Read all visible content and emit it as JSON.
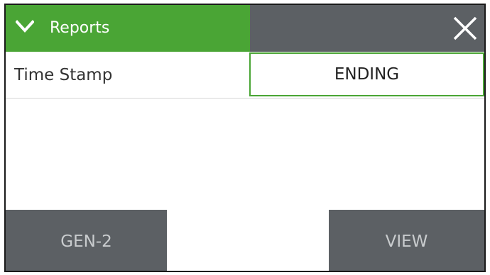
{
  "header": {
    "title": "Reports",
    "chevron_icon": "chevron-down-icon",
    "close_icon": "close-icon",
    "accent_color": "#4aa535",
    "bar_color": "#5c6064"
  },
  "setting": {
    "label": "Time Stamp",
    "value": "ENDING"
  },
  "footer": {
    "left_button_label": "GEN-2",
    "right_button_label": "VIEW"
  }
}
